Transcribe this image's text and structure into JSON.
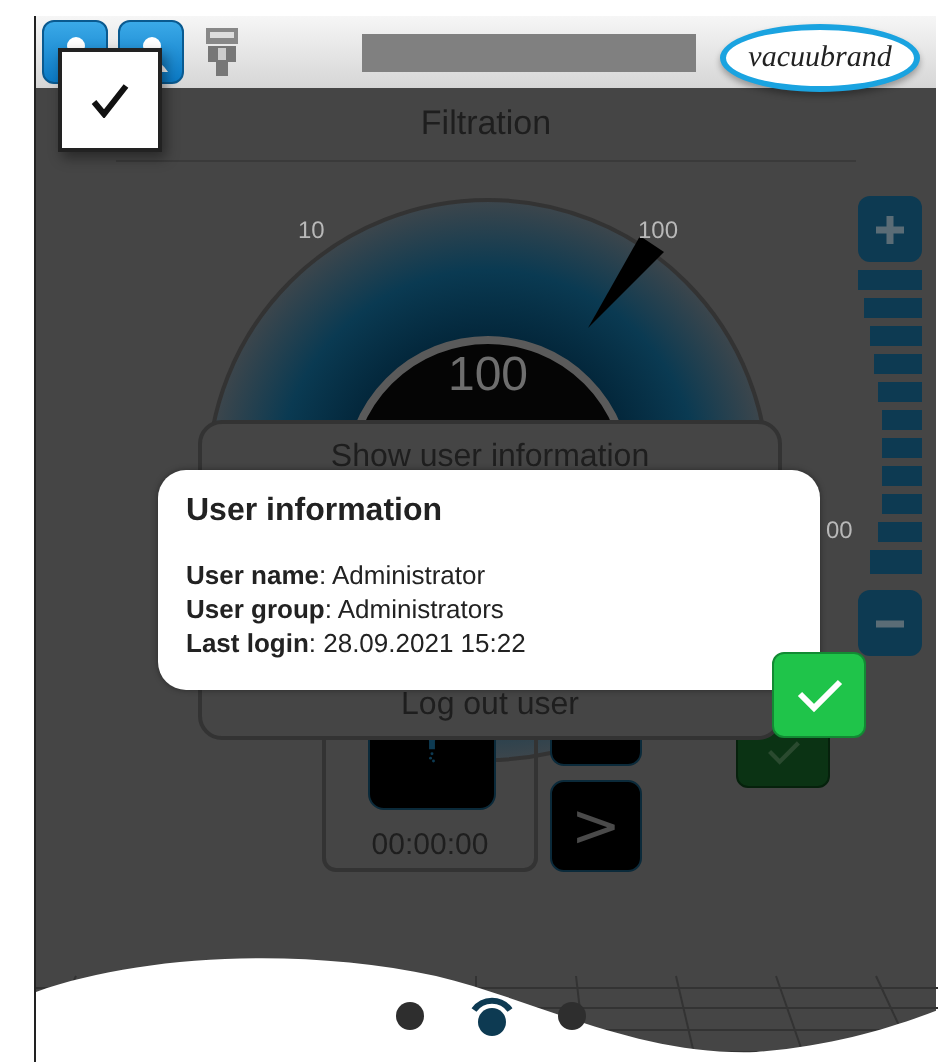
{
  "top_bar": {
    "logo": "vacuubrand"
  },
  "screen": {
    "title": "Filtration",
    "gauge": {
      "tick_labels": [
        "10",
        "100"
      ],
      "value": "100"
    },
    "side_reading": "00",
    "menu": {
      "items": [
        "Show user information",
        "Log out user"
      ]
    },
    "timer": "00:00:00",
    "next_button": ">",
    "page_dots": [
      {
        "selected": false
      },
      {
        "selected": true
      },
      {
        "selected": false
      }
    ]
  },
  "dialog": {
    "title": "User information",
    "lines": [
      "**User name**: Administrator",
      "**User group**: Administrators",
      "**Last login**: 28.09.2021 15:22"
    ]
  }
}
